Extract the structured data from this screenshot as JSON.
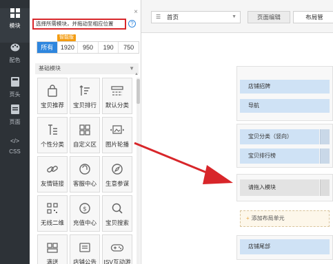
{
  "rail": {
    "items": [
      {
        "label": "模块",
        "icon": "grid-icon"
      },
      {
        "label": "配色",
        "icon": "palette-icon"
      },
      {
        "label": "页头",
        "icon": "header-icon"
      },
      {
        "label": "页面",
        "icon": "page-icon"
      },
      {
        "label": "CSS",
        "icon": "code-icon",
        "glyph": "</>"
      }
    ]
  },
  "panel": {
    "close": "×",
    "hint": "选择所需模块，并拖动至相应位置",
    "help": "?",
    "badge": "智能版",
    "filters": [
      "所有",
      "1920",
      "950",
      "190",
      "750"
    ],
    "section_title": "基础模块",
    "modules": [
      {
        "label": "宝贝推荐",
        "icon": "bag-icon"
      },
      {
        "label": "宝贝排行",
        "icon": "sort-icon"
      },
      {
        "label": "默认分类",
        "icon": "category-icon"
      },
      {
        "label": "个性分类",
        "icon": "custom-category-icon"
      },
      {
        "label": "自定义区",
        "icon": "custom-area-icon"
      },
      {
        "label": "图片轮播",
        "icon": "image-carousel-icon"
      },
      {
        "label": "友情链接",
        "icon": "link-icon"
      },
      {
        "label": "客服中心",
        "icon": "service-icon"
      },
      {
        "label": "生意参谋",
        "icon": "compass-icon"
      },
      {
        "label": "无线二维",
        "icon": "qrcode-icon"
      },
      {
        "label": "充值中心",
        "icon": "recharge-icon"
      },
      {
        "label": "宝贝搜索",
        "icon": "search-icon"
      },
      {
        "label": "满送",
        "icon": "gift-grid-icon"
      },
      {
        "label": "店铺公告",
        "icon": "notice-icon"
      },
      {
        "label": "ISV互动游",
        "icon": "gamepad-icon"
      }
    ]
  },
  "topbar": {
    "page_select": "首页",
    "tab_edit": "页面编辑",
    "tab_layout": "布局管"
  },
  "canvas": {
    "rows": {
      "shop_sign": "店铺招牌",
      "nav": "导航",
      "category": "宝贝分类（竖向）",
      "ranking": "宝贝排行榜",
      "drop_here": "请拖入模块",
      "add_unit": "添加布局单元",
      "footer": "店铺尾部"
    }
  },
  "colors": {
    "rail_bg": "#2d3237",
    "accent_blue": "#2e86de",
    "highlight_red": "#d8262a",
    "row_blue": "#cfe2f5",
    "badge_orange": "#f39c12"
  }
}
